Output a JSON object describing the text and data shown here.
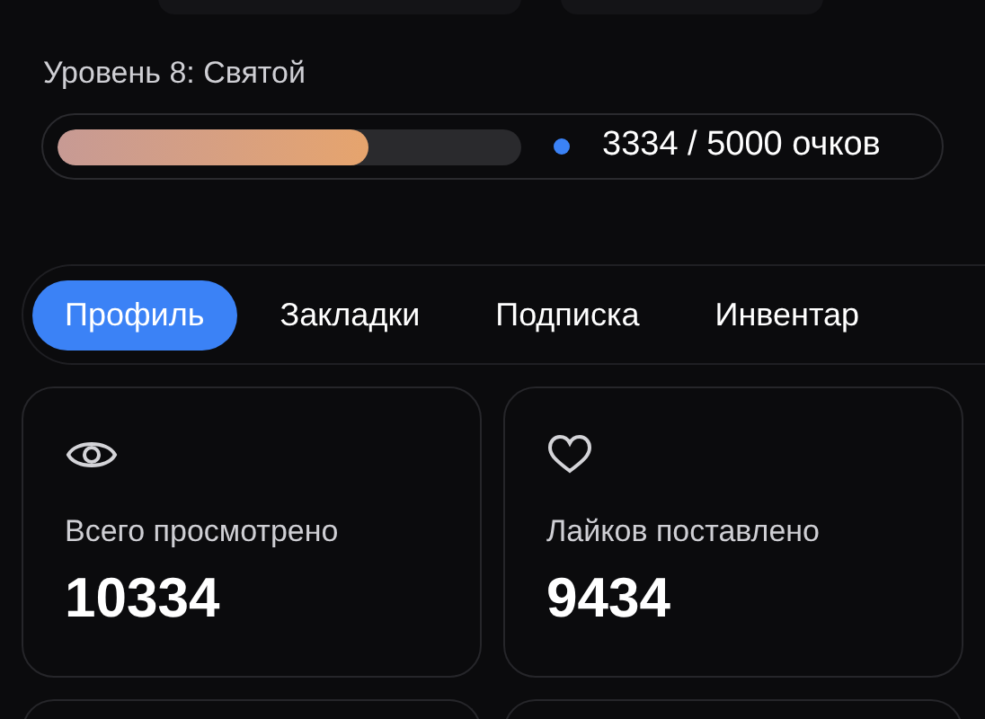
{
  "level": {
    "title": "Уровень 8: Святой",
    "level": 0.67,
    "reading": "3334 / 5000 очков",
    "color": "#3b82f6"
  },
  "tabs": [
    {
      "label": "Профиль",
      "selected": true
    },
    {
      "label": "Закладки",
      "selected": false
    },
    {
      "label": "Подписка",
      "selected": false
    },
    {
      "label": "Инвентар",
      "selected": false
    }
  ],
  "stats": [
    {
      "kind": "eye",
      "label": "Всего просмотрено",
      "value": "10334"
    },
    {
      "kind": "heart",
      "label": "Лайков поставлено",
      "value": "9434"
    }
  ]
}
